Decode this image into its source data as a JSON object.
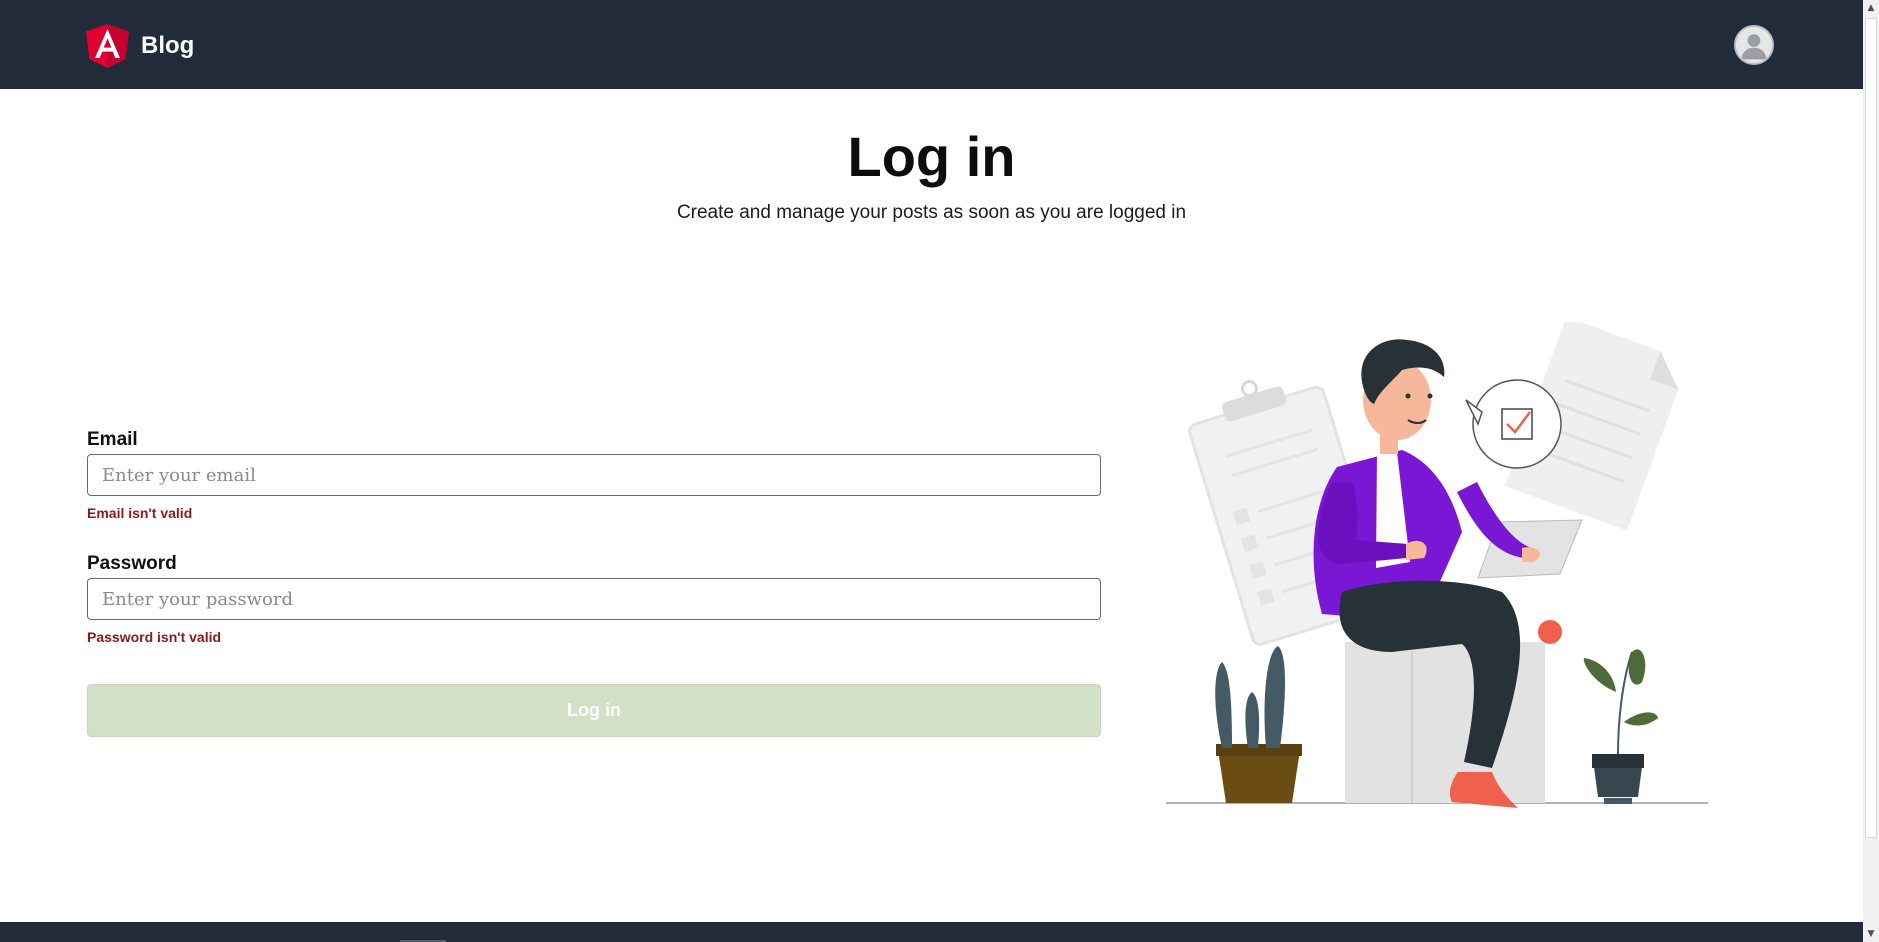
{
  "navbar": {
    "brand_name": "Blog",
    "logo_icon": "angular-logo-icon",
    "avatar_icon": "user-avatar-icon",
    "background": "#212b3a"
  },
  "page": {
    "title": "Log in",
    "subtitle": "Create and manage your posts as soon as you are logged in"
  },
  "form": {
    "email": {
      "label": "Email",
      "placeholder": "Enter your email",
      "value": "",
      "error": "Email isn't valid"
    },
    "password": {
      "label": "Password",
      "placeholder": "Enter your password",
      "value": "",
      "error": "Password isn't valid"
    },
    "submit_label": "Log in",
    "submit_disabled": true
  },
  "illustration": {
    "icon": "person-with-laptop-illustration"
  },
  "colors": {
    "accent_purple": "#7a17d4",
    "error_text": "#8b1a1a",
    "button_disabled": "#d3e0c8",
    "logo_red": "#dd0031"
  }
}
